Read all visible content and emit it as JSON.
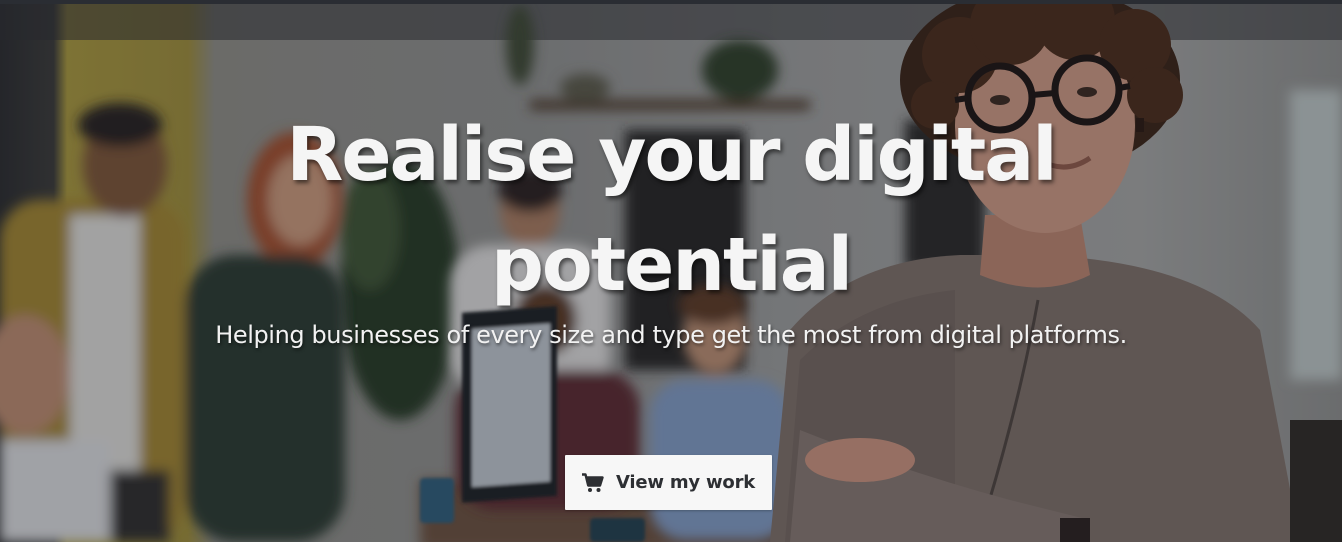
{
  "hero": {
    "title_line_1": "Realise your digital",
    "title_line_2": "potential",
    "subtitle": "Helping businesses of every size and type get the most from digital platforms.",
    "cta": {
      "label": "View my work",
      "icon": "shopping-cart-icon"
    },
    "background": "office team photo with woman in glasses in foreground"
  },
  "colors": {
    "title_text": "#f5f5f5",
    "button_bg": "#f7f7f7",
    "button_text": "#2d2f33"
  }
}
